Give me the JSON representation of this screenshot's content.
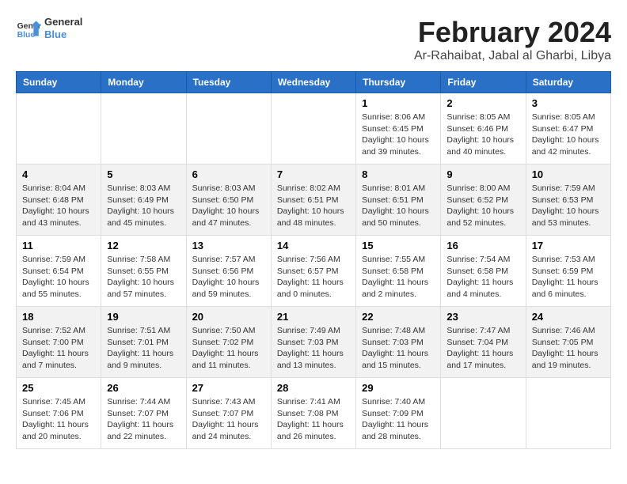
{
  "logo": {
    "text_general": "General",
    "text_blue": "Blue"
  },
  "title": "February 2024",
  "subtitle": "Ar-Rahaibat, Jabal al Gharbi, Libya",
  "headers": [
    "Sunday",
    "Monday",
    "Tuesday",
    "Wednesday",
    "Thursday",
    "Friday",
    "Saturday"
  ],
  "weeks": [
    {
      "group": "row-group-1",
      "days": [
        {
          "num": "",
          "text": ""
        },
        {
          "num": "",
          "text": ""
        },
        {
          "num": "",
          "text": ""
        },
        {
          "num": "",
          "text": ""
        },
        {
          "num": "1",
          "text": "Sunrise: 8:06 AM\nSunset: 6:45 PM\nDaylight: 10 hours\nand 39 minutes."
        },
        {
          "num": "2",
          "text": "Sunrise: 8:05 AM\nSunset: 6:46 PM\nDaylight: 10 hours\nand 40 minutes."
        },
        {
          "num": "3",
          "text": "Sunrise: 8:05 AM\nSunset: 6:47 PM\nDaylight: 10 hours\nand 42 minutes."
        }
      ]
    },
    {
      "group": "row-group-2",
      "days": [
        {
          "num": "4",
          "text": "Sunrise: 8:04 AM\nSunset: 6:48 PM\nDaylight: 10 hours\nand 43 minutes."
        },
        {
          "num": "5",
          "text": "Sunrise: 8:03 AM\nSunset: 6:49 PM\nDaylight: 10 hours\nand 45 minutes."
        },
        {
          "num": "6",
          "text": "Sunrise: 8:03 AM\nSunset: 6:50 PM\nDaylight: 10 hours\nand 47 minutes."
        },
        {
          "num": "7",
          "text": "Sunrise: 8:02 AM\nSunset: 6:51 PM\nDaylight: 10 hours\nand 48 minutes."
        },
        {
          "num": "8",
          "text": "Sunrise: 8:01 AM\nSunset: 6:51 PM\nDaylight: 10 hours\nand 50 minutes."
        },
        {
          "num": "9",
          "text": "Sunrise: 8:00 AM\nSunset: 6:52 PM\nDaylight: 10 hours\nand 52 minutes."
        },
        {
          "num": "10",
          "text": "Sunrise: 7:59 AM\nSunset: 6:53 PM\nDaylight: 10 hours\nand 53 minutes."
        }
      ]
    },
    {
      "group": "row-group-3",
      "days": [
        {
          "num": "11",
          "text": "Sunrise: 7:59 AM\nSunset: 6:54 PM\nDaylight: 10 hours\nand 55 minutes."
        },
        {
          "num": "12",
          "text": "Sunrise: 7:58 AM\nSunset: 6:55 PM\nDaylight: 10 hours\nand 57 minutes."
        },
        {
          "num": "13",
          "text": "Sunrise: 7:57 AM\nSunset: 6:56 PM\nDaylight: 10 hours\nand 59 minutes."
        },
        {
          "num": "14",
          "text": "Sunrise: 7:56 AM\nSunset: 6:57 PM\nDaylight: 11 hours\nand 0 minutes."
        },
        {
          "num": "15",
          "text": "Sunrise: 7:55 AM\nSunset: 6:58 PM\nDaylight: 11 hours\nand 2 minutes."
        },
        {
          "num": "16",
          "text": "Sunrise: 7:54 AM\nSunset: 6:58 PM\nDaylight: 11 hours\nand 4 minutes."
        },
        {
          "num": "17",
          "text": "Sunrise: 7:53 AM\nSunset: 6:59 PM\nDaylight: 11 hours\nand 6 minutes."
        }
      ]
    },
    {
      "group": "row-group-4",
      "days": [
        {
          "num": "18",
          "text": "Sunrise: 7:52 AM\nSunset: 7:00 PM\nDaylight: 11 hours\nand 7 minutes."
        },
        {
          "num": "19",
          "text": "Sunrise: 7:51 AM\nSunset: 7:01 PM\nDaylight: 11 hours\nand 9 minutes."
        },
        {
          "num": "20",
          "text": "Sunrise: 7:50 AM\nSunset: 7:02 PM\nDaylight: 11 hours\nand 11 minutes."
        },
        {
          "num": "21",
          "text": "Sunrise: 7:49 AM\nSunset: 7:03 PM\nDaylight: 11 hours\nand 13 minutes."
        },
        {
          "num": "22",
          "text": "Sunrise: 7:48 AM\nSunset: 7:03 PM\nDaylight: 11 hours\nand 15 minutes."
        },
        {
          "num": "23",
          "text": "Sunrise: 7:47 AM\nSunset: 7:04 PM\nDaylight: 11 hours\nand 17 minutes."
        },
        {
          "num": "24",
          "text": "Sunrise: 7:46 AM\nSunset: 7:05 PM\nDaylight: 11 hours\nand 19 minutes."
        }
      ]
    },
    {
      "group": "row-group-5",
      "days": [
        {
          "num": "25",
          "text": "Sunrise: 7:45 AM\nSunset: 7:06 PM\nDaylight: 11 hours\nand 20 minutes."
        },
        {
          "num": "26",
          "text": "Sunrise: 7:44 AM\nSunset: 7:07 PM\nDaylight: 11 hours\nand 22 minutes."
        },
        {
          "num": "27",
          "text": "Sunrise: 7:43 AM\nSunset: 7:07 PM\nDaylight: 11 hours\nand 24 minutes."
        },
        {
          "num": "28",
          "text": "Sunrise: 7:41 AM\nSunset: 7:08 PM\nDaylight: 11 hours\nand 26 minutes."
        },
        {
          "num": "29",
          "text": "Sunrise: 7:40 AM\nSunset: 7:09 PM\nDaylight: 11 hours\nand 28 minutes."
        },
        {
          "num": "",
          "text": ""
        },
        {
          "num": "",
          "text": ""
        }
      ]
    }
  ]
}
